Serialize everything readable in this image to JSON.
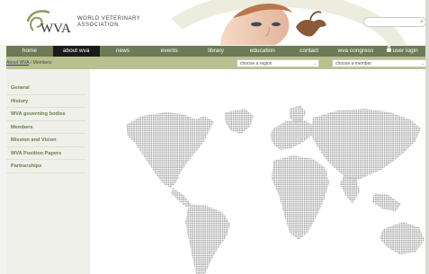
{
  "header": {
    "logo_text": "WVA",
    "org_line1": "WORLD VETERINARY",
    "org_line2": "ASSOCIATION",
    "search_placeholder": ""
  },
  "nav": {
    "items": [
      {
        "label": "home"
      },
      {
        "label": "about wva"
      },
      {
        "label": "news"
      },
      {
        "label": "events"
      },
      {
        "label": "library"
      },
      {
        "label": "education"
      },
      {
        "label": "contact"
      },
      {
        "label": "wva congress"
      },
      {
        "label": "user login"
      }
    ]
  },
  "breadcrumb": {
    "link": "About WVA",
    "current": "Members"
  },
  "selects": {
    "region": "choose a region",
    "member": "choose a member"
  },
  "sidebar": {
    "items": [
      {
        "label": "General"
      },
      {
        "label": "History"
      },
      {
        "label": "WVA governing bodies"
      },
      {
        "label": "Members"
      },
      {
        "label": "Mission and Vision"
      },
      {
        "label": "WVA Position Papers"
      },
      {
        "label": "Partnerships"
      }
    ]
  },
  "colors": {
    "nav_bg": "#6e7a55",
    "nav_active": "#1a1a1a",
    "subbar_bg": "#b7c08e",
    "sidebar_text": "#6c7a48",
    "map_dot": "#a0a0a0"
  }
}
